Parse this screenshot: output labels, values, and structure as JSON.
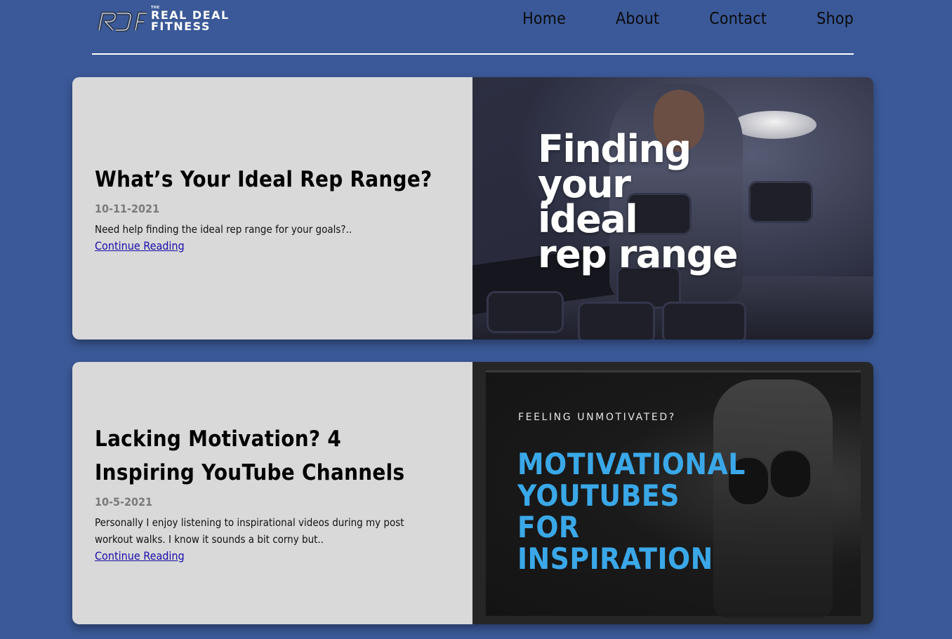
{
  "header": {
    "logo": {
      "mark": "RDF",
      "the": "THE",
      "line1": "REAL DEAL",
      "line2": "FITNESS"
    },
    "nav": [
      {
        "label": "Home"
      },
      {
        "label": "About"
      },
      {
        "label": "Contact"
      },
      {
        "label": "Shop"
      }
    ]
  },
  "posts": [
    {
      "title": "What’s Your Ideal Rep Range?",
      "date": "10-11-2021",
      "excerpt": "Need help finding the ideal rep range for your goals?..",
      "link_label": "Continue Reading",
      "image_text": [
        "Finding",
        "your",
        "ideal",
        "rep range"
      ]
    },
    {
      "title": "Lacking Motivation? 4 Inspiring YouTube Channels",
      "date": "10-5-2021",
      "excerpt": "Personally I enjoy listening to inspirational videos during my post workout walks. I know it sounds a bit corny but..",
      "link_label": "Continue Reading",
      "image_kicker": "FEELING UNMOTIVATED?",
      "image_text": [
        "MOTIVATIONAL",
        "YOUTUBES",
        "FOR",
        "INSPIRATION"
      ]
    }
  ],
  "colors": {
    "page_background": "#3b5998",
    "card_text_background": "#d9d9d9",
    "link": "#1a0dab",
    "date": "#7a7a7a",
    "poster_accent": "#3aa8e8"
  },
  "icons": {
    "logo": "rdf-logo-icon"
  }
}
